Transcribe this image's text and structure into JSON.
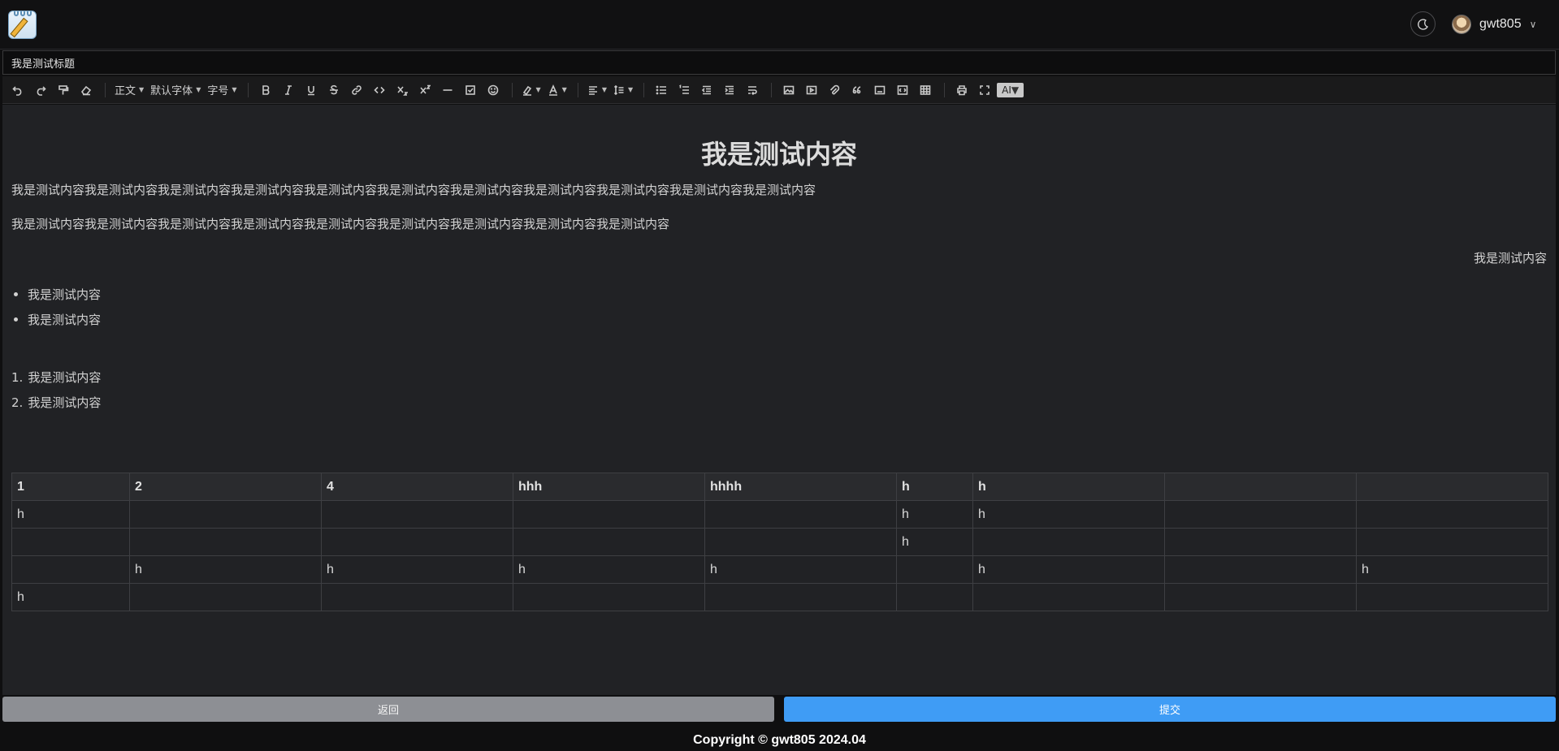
{
  "header": {
    "user_name": "gwt805",
    "logo_icon": "notepad-pencil-icon",
    "theme_icon": "theme-toggle-icon"
  },
  "title_input": {
    "value": "我是测试标题"
  },
  "toolbar": {
    "paragraph_label": "正文",
    "font_label": "默认字体",
    "size_label": "字号",
    "ai_label": "AI"
  },
  "document": {
    "heading": "我是测试内容",
    "para1": "我是测试内容我是测试内容我是测试内容我是测试内容我是测试内容我是测试内容我是测试内容我是测试内容我是测试内容我是测试内容我是测试内容",
    "para2": "我是测试内容我是测试内容我是测试内容我是测试内容我是测试内容我是测试内容我是测试内容我是测试内容我是测试内容",
    "para_right": "我是测试内容",
    "bullets": [
      "我是测试内容",
      "我是测试内容"
    ],
    "numbered": [
      {
        "num": "1.",
        "text": "我是测试内容"
      },
      {
        "num": "2.",
        "text": "我是测试内容"
      }
    ],
    "table": {
      "header": [
        "1",
        "2",
        "4",
        "hhh",
        "hhhh",
        "h",
        "h",
        "",
        ""
      ],
      "rows": [
        [
          "h",
          "",
          "",
          "",
          "",
          "h",
          "h",
          "",
          ""
        ],
        [
          "",
          "",
          "",
          "",
          "",
          "h",
          "",
          "",
          ""
        ],
        [
          "",
          "h",
          "h",
          "h",
          "h",
          "",
          "h",
          "",
          "h"
        ],
        [
          "h",
          "",
          "",
          "",
          "",
          "",
          "",
          "",
          ""
        ]
      ]
    }
  },
  "actions": {
    "back_label": "返回",
    "submit_label": "提交"
  },
  "footer": {
    "copyright": "Copyright © gwt805 2024.04"
  }
}
